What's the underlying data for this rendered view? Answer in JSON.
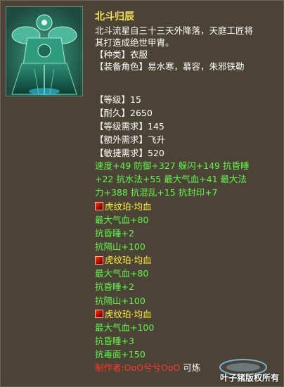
{
  "item": {
    "name": "北斗归辰",
    "description_lines": [
      "北斗流星自三十三天外降落，天庭工匠将",
      "其打造成绝世甲胄。"
    ],
    "type_line": "【种类】衣服",
    "roles_line": "【装备角色】易水寒，慕容，朱邪铁勒"
  },
  "stats": [
    "【等级】15",
    "【耐久】2650",
    "【等级需求】145",
    "【额外需求】飞升",
    "【敏捷需求】520"
  ],
  "extra_attrs": [
    "速度+49  防御+327  躲闪+149  抗昏睡",
    "+22  抗水法+55  最大气血+41  最大法",
    "力+388  抗混乱+15  抗封印+7"
  ],
  "gems": [
    {
      "name": "虎纹珀·均血",
      "attrs": [
        "最大气血+80",
        "抗昏睡+2",
        "抗隔山+100"
      ]
    },
    {
      "name": "虎纹珀·均血",
      "attrs": [
        "最大气血+80",
        "抗昏睡+2",
        "抗隔山+100"
      ]
    },
    {
      "name": "虎纹珀·均血",
      "attrs": [
        "最大气血+100",
        "抗昏睡+3",
        "抗毒面+150"
      ]
    }
  ],
  "maker": {
    "label": "制作者:OoO兮兮OoO",
    "suffix": "可炼"
  },
  "watermark": "叶子猪版权所有",
  "colors": {
    "title": "#f6e25a",
    "green": "#62f44c",
    "gem": "#ffee3a",
    "maker": "#ff3a2a",
    "background": "#4b4336"
  }
}
